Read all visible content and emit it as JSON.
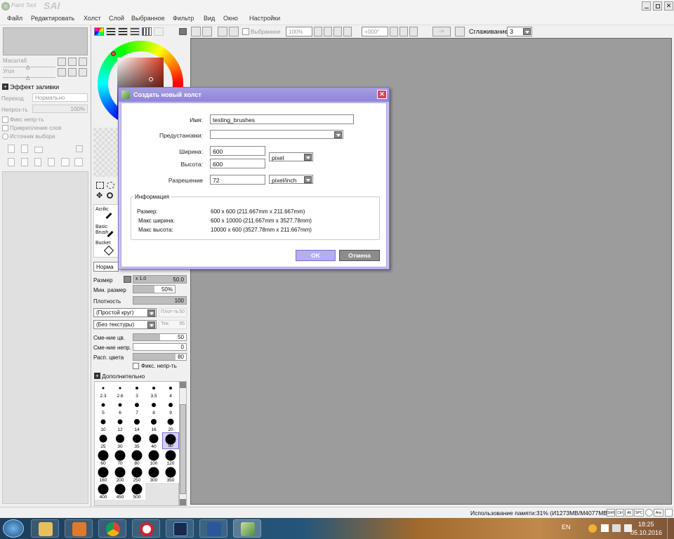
{
  "app": {
    "logo_text": "SAI",
    "logo_small": "Paint Tool"
  },
  "menu": [
    "Файл",
    "Редактировать",
    "Холст",
    "Слой",
    "Выбранное",
    "Фильтр",
    "Вид",
    "Окно",
    "Настройки"
  ],
  "toolbar": {
    "selection_label": "Выбранное",
    "zoom": "100%",
    "rotation": "+000°",
    "arrow": "->",
    "smoothing_label": "Сглаживание",
    "smoothing_value": "3"
  },
  "left_panel": {
    "zoom_label": "Масштаб",
    "zoom_value": "Δ",
    "angle_label": "Угол",
    "angle_value": "Δ",
    "fill_effect": "Эффект заливки",
    "transition_label": "Переход",
    "transition_value": "Нормально",
    "opacity_label": "Непроз-ть",
    "opacity_value": "100%",
    "checks": [
      "Фикс непр-ть",
      "Прикрепление слоя",
      "Источник выбора"
    ]
  },
  "tools": {
    "brushes": [
      "Acrilic",
      "Basic Brush",
      "Bucket"
    ],
    "blend_mode": "Норма",
    "size_label": "Размер",
    "size_mult": "x 1.0",
    "size_value": "50.0",
    "min_size_label": "Мин. размер",
    "min_size_value": "50%",
    "min_size_fill": 0.5,
    "density_label": "Плотность",
    "density_value": "100",
    "density_fill": 1.0,
    "shape": "(Простой круг)",
    "shape_val_label": "Плот-ть",
    "shape_val": "50",
    "texture": "(Без текстуры)",
    "texture_val_label": "Тек.",
    "texture_val": "95",
    "blend_label": "Сме-ние цв.",
    "blend_value": "50",
    "blend_fill": 0.5,
    "mix_label": "Сме-ние непр.",
    "mix_value": "0",
    "mix_fill": 0,
    "spread_label": "Расп. цвета",
    "spread_value": "80",
    "spread_fill": 0.8,
    "fix_opacity": "Фикс. непр-ть",
    "advanced": "Дополнительно"
  },
  "brush_sizes": [
    "2.3",
    "2.6",
    "3",
    "3.5",
    "4",
    "5",
    "6",
    "7",
    "8",
    "9",
    "10",
    "12",
    "14",
    "16",
    "20",
    "25",
    "30",
    "35",
    "40",
    "50",
    "60",
    "70",
    "80",
    "100",
    "120",
    "160",
    "200",
    "250",
    "300",
    "350",
    "400",
    "450",
    "500"
  ],
  "selected_brush_size": "50",
  "dialog": {
    "title": "Создать новый холст",
    "name_label": "Имя:",
    "name_value": "testing_brushes",
    "preset_label": "Предустановки:",
    "preset_value": "",
    "width_label": "Ширина:",
    "width_value": "600",
    "height_label": "Высота:",
    "height_value": "600",
    "unit": "pixel",
    "res_label": "Разрешение",
    "res_value": "72",
    "res_unit": "pixel/inch",
    "info_title": "Информация",
    "size_label": "Размер:",
    "size_value": "600 x 600 (211.667mm x 211.667mm)",
    "maxw_label": "Макс ширина:",
    "maxw_value": "600 x 10000 (211.667mm x 3527.78mm)",
    "maxh_label": "Макс высота:",
    "maxh_value": "10000 x 600 (3527.78mm x 211.667mm)",
    "ok": "OK",
    "cancel": "Отмена"
  },
  "status": {
    "memory": "Использование памяти:31% (И1273МВ/М4077МВ)",
    "keys": [
      "Shift",
      "Ctrl",
      "Alt",
      "SPC"
    ],
    "any": "Any"
  },
  "taskbar": {
    "lang": "EN",
    "time": "18:25",
    "date": "05.10.2016"
  },
  "colors": {
    "accent": "#8e85d6",
    "canvas": "#9c9c9c",
    "ok": "#b4aef0",
    "cancel": "#8c8c8c"
  }
}
